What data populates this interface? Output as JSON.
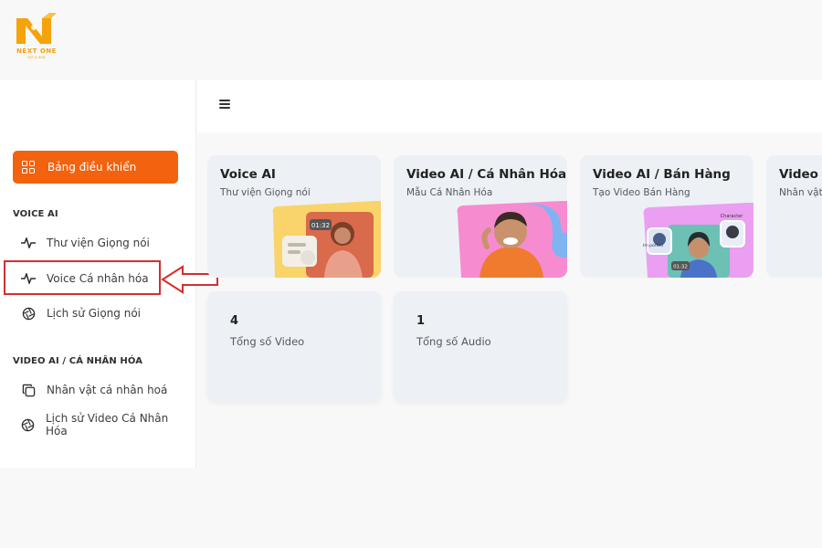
{
  "brand": {
    "name": "NEXT ONE",
    "tagline": "SET & RUN",
    "accent": "#f2620f"
  },
  "sidebar": {
    "dashboard_label": "Bảng điều khiển",
    "sections": [
      {
        "title": "VOICE AI",
        "items": [
          {
            "label": "Thư viện Giọng nói",
            "icon": "waveform-icon"
          },
          {
            "label": "Voice Cá nhân hóa",
            "icon": "waveform-icon"
          },
          {
            "label": "Lịch sử Giọng nói",
            "icon": "aperture-icon"
          }
        ]
      },
      {
        "title": "VIDEO AI / CÁ NHÂN HÓA",
        "items": [
          {
            "label": "Nhân vật cá nhân hoá",
            "icon": "copy-icon"
          },
          {
            "label": "Lịch sử Video Cá Nhân Hóa",
            "icon": "aperture-icon"
          }
        ]
      }
    ]
  },
  "cards": [
    {
      "title": "Voice AI",
      "subtitle": "Thư viện Giọng nói",
      "badge": "01:32"
    },
    {
      "title": "Video AI / Cá Nhân Hóa",
      "subtitle": "Mẫu Cá Nhân Hóa"
    },
    {
      "title": "Video AI / Bán Hàng",
      "subtitle": "Tạo Video Bán Hàng",
      "badge": "01:32",
      "tag1": "Character",
      "tag2": "Im ported"
    },
    {
      "title": "Video A",
      "subtitle": "Nhân vật p"
    }
  ],
  "stats": [
    {
      "value": "4",
      "label": "Tổng số Video"
    },
    {
      "value": "1",
      "label": "Tổng số Audio"
    }
  ]
}
